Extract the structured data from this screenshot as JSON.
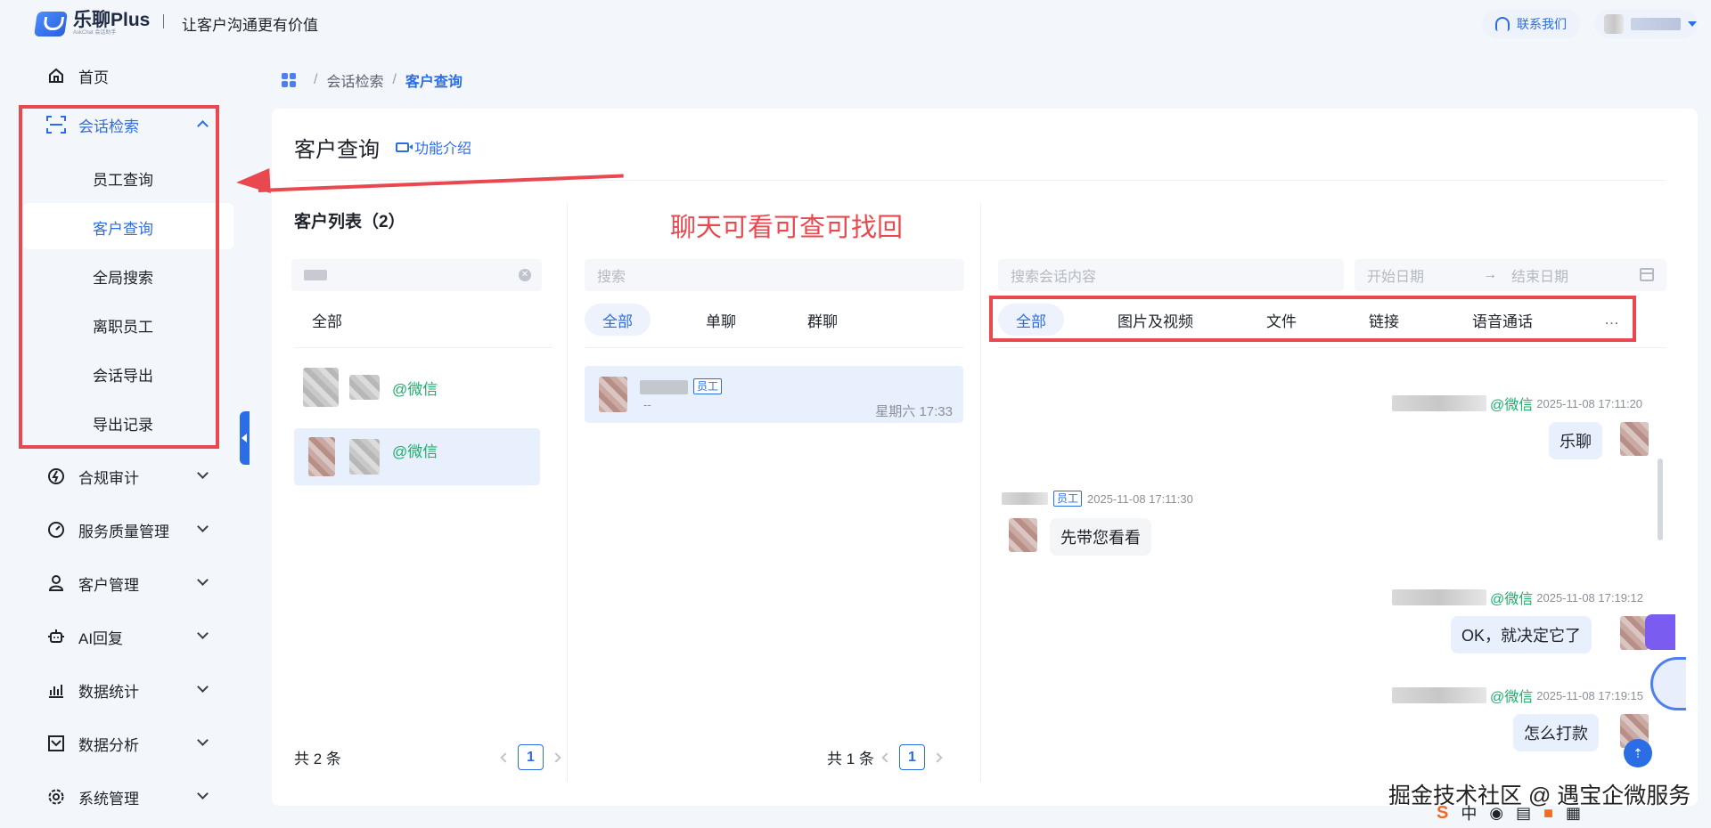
{
  "header": {
    "logo_name": "乐聊Plus",
    "logo_sub": "AskChat 会话助手",
    "slogan": "让客户沟通更有价值",
    "contact": "联系我们"
  },
  "sidebar": {
    "home": "首页",
    "session_search": "会话检索",
    "sub_items": [
      "员工查询",
      "客户查询",
      "全局搜索",
      "离职员工",
      "会话导出",
      "导出记录"
    ],
    "compliance": "合规审计",
    "service_quality": "服务质量管理",
    "customer_mgmt": "客户管理",
    "ai_reply": "AI回复",
    "data_stats": "数据统计",
    "data_analysis": "数据分析",
    "system_mgmt": "系统管理"
  },
  "breadcrumb": {
    "level1": "会话检索",
    "level2": "客户查询",
    "sep": "/"
  },
  "page": {
    "title": "客户查询",
    "intro_link": "功能介绍"
  },
  "customer_panel": {
    "title": "客户列表（2）",
    "filter_all": "全部",
    "rows": [
      {
        "tag": "@微信"
      },
      {
        "tag": "@微信"
      }
    ],
    "total": "共 2 条",
    "page": "1"
  },
  "conv_panel": {
    "search_placeholder": "搜索",
    "tabs": [
      "全部",
      "单聊",
      "群聊"
    ],
    "item": {
      "badge": "员工",
      "sub": "--",
      "time": "星期六 17:33"
    },
    "total": "共 1 条",
    "page": "1"
  },
  "annotation": "聊天可看可查可找回",
  "msg_panel": {
    "search_placeholder": "搜索会话内容",
    "start_date": "开始日期",
    "date_sep": "→",
    "end_date": "结束日期",
    "tabs": [
      "全部",
      "图片及视频",
      "文件",
      "链接",
      "语音通话"
    ],
    "tab_more": "…",
    "messages": [
      {
        "tag": "@微信",
        "time": "2025-11-08 17:11:20",
        "text": "乐聊"
      },
      {
        "badge": "员工",
        "time": "2025-11-08 17:11:30",
        "text": "先带您看看"
      },
      {
        "tag": "@微信",
        "time": "2025-11-08 17:19:12",
        "text": "OK，就决定它了"
      },
      {
        "tag": "@微信",
        "time": "2025-11-08 17:19:15",
        "text": "怎么打款"
      }
    ]
  },
  "watermark": "掘金技术社区 @ 遇宝企微服务",
  "ime": {
    "s": "S",
    "zh": "中"
  },
  "colors": {
    "accent": "#2b6de5",
    "annotation_red": "#e8484e",
    "wechat_green": "#1cae6a"
  }
}
